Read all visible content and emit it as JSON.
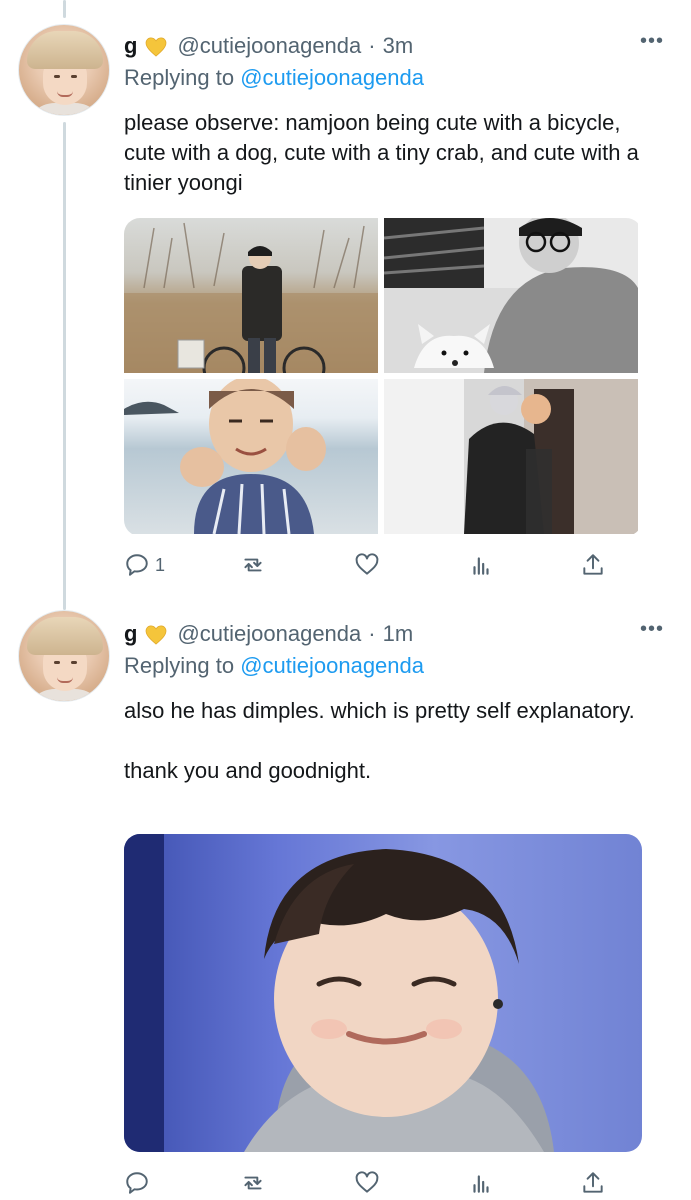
{
  "tweets": [
    {
      "name": "g",
      "handle": "@cutiejoonagenda",
      "dot": "·",
      "time": "3m",
      "more": "•••",
      "reply_prefix": "Replying to ",
      "reply_mention": "@cutiejoonagenda",
      "text": "please observe: namjoon being cute with a bicycle, cute with a dog, cute with a tiny crab, and cute with a tinier yoongi",
      "media": [
        "photo-bicycle",
        "photo-dog",
        "photo-crab",
        "photo-yoongi"
      ],
      "reply_count": "1"
    },
    {
      "name": "g",
      "handle": "@cutiejoonagenda",
      "dot": "·",
      "time": "1m",
      "more": "•••",
      "reply_prefix": "Replying to ",
      "reply_mention": "@cutiejoonagenda",
      "text": "also he has dimples. which is pretty self explanatory.\n\nthank you and goodnight.",
      "media": [
        "photo-dimples"
      ],
      "reply_count": ""
    }
  ],
  "colors": {
    "text": "#14171a",
    "secondary": "#536471",
    "link": "#1d9bf0",
    "heart_emoji": "#f5c53b",
    "thread_line": "#cfd9de"
  },
  "icons": [
    "reply-icon",
    "retweet-icon",
    "like-icon",
    "analytics-icon",
    "share-icon",
    "more-icon",
    "yellow-heart-icon"
  ]
}
